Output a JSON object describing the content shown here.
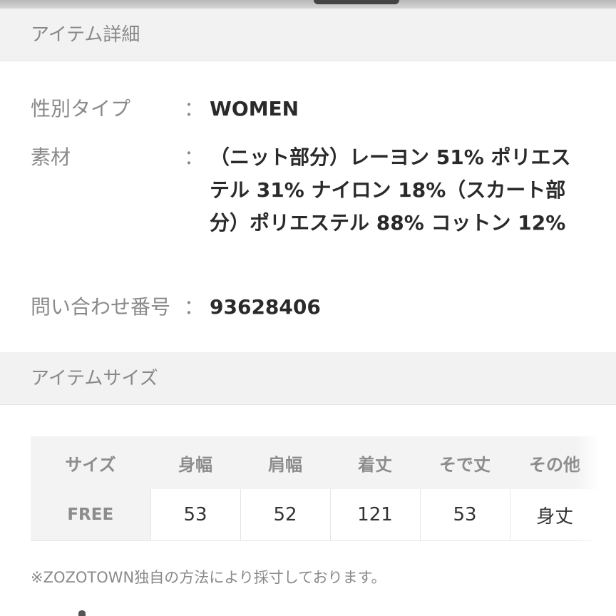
{
  "item_detail": {
    "header": "アイテム詳細",
    "rows": [
      {
        "label": "性別タイプ",
        "colon": "：",
        "value": "WOMEN"
      },
      {
        "label": "素材",
        "colon": "：",
        "value": "（ニット部分）レーヨン 51% ポリエステル 31% ナイロン 18%（スカート部分）ポリエステル 88% コットン 12%"
      },
      {
        "label": "問い合わせ番号",
        "colon": "：",
        "value": "93628406"
      }
    ]
  },
  "item_size": {
    "header": "アイテムサイズ",
    "columns": [
      "サイズ",
      "身幅",
      "肩幅",
      "着丈",
      "そで丈",
      "その他"
    ],
    "rows": [
      {
        "cells": [
          "FREE",
          "53",
          "52",
          "121",
          "53",
          "身丈"
        ]
      }
    ],
    "note": "※ZOZOTOWN独自の方法により採寸しております。"
  }
}
